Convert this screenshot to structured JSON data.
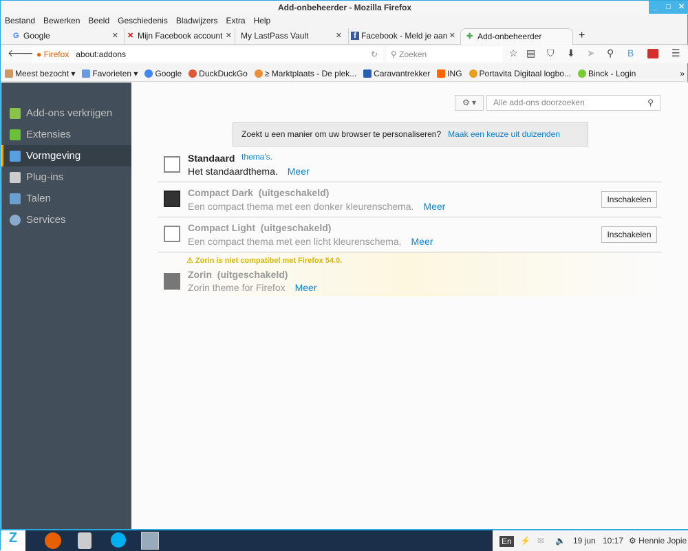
{
  "window": {
    "title": "Add-onbeheerder - Mozilla Firefox",
    "controls": [
      "_",
      "□",
      "✕"
    ]
  },
  "menu": [
    "Bestand",
    "Bewerken",
    "Beeld",
    "Geschiedenis",
    "Bladwijzers",
    "Extra",
    "Help"
  ],
  "tabs": [
    {
      "label": "Google",
      "icon": "G",
      "color": "#4285f4"
    },
    {
      "label": "Mijn Facebook account",
      "icon": "✕",
      "color": "#d00"
    },
    {
      "label": "My LastPass Vault",
      "icon": "",
      "color": "#333"
    },
    {
      "label": "Facebook - Meld je aan",
      "icon": "f",
      "color": "#3b5998"
    },
    {
      "label": "Add-onbeheerder",
      "icon": "✚",
      "color": "#4caf50",
      "active": true
    }
  ],
  "new_tab": "+",
  "nav": {
    "identity": "Firefox",
    "url": "about:addons",
    "search_placeholder": "Zoeken"
  },
  "bookmarks": [
    {
      "label": "Meest bezocht ▾",
      "color": "#c96"
    },
    {
      "label": "Favorieten ▾",
      "color": "#6a9be0"
    },
    {
      "label": "Google",
      "color": "#4285f4"
    },
    {
      "label": "DuckDuckGo",
      "color": "#de5833"
    },
    {
      "label": "≥ Marktplaats - De plek...",
      "color": "#e8913a"
    },
    {
      "label": "Caravantrekker",
      "color": "#2a5fb0"
    },
    {
      "label": "ING",
      "color": "#f60"
    },
    {
      "label": "Portavita Digitaal logbo...",
      "color": "#e8a020"
    },
    {
      "label": "Binck - Login",
      "color": "#7c3"
    }
  ],
  "bookmarks_more": "»",
  "sidebar": [
    {
      "label": "Add-ons verkrijgen",
      "color": "#8bc34a"
    },
    {
      "label": "Extensies",
      "color": "#6bbf3a"
    },
    {
      "label": "Vormgeving",
      "color": "#5aa0e0",
      "selected": true
    },
    {
      "label": "Plug-ins",
      "color": "#ccc"
    },
    {
      "label": "Talen",
      "color": "#6aa0d0"
    },
    {
      "label": "Services",
      "color": "#8ac"
    }
  ],
  "search": {
    "placeholder": "Alle add-ons doorzoeken"
  },
  "banner": {
    "text": "Zoekt u een manier om uw browser te personaliseren?",
    "link": "Maak een keuze uit duizenden thema's."
  },
  "themes": [
    {
      "name": "Standaard",
      "status": "",
      "desc": "Het standaardthema.",
      "more": "Meer",
      "button": ""
    },
    {
      "name": "Compact Dark",
      "status": "(uitgeschakeld)",
      "desc": "Een compact thema met een donker kleurenschema.",
      "more": "Meer",
      "button": "Inschakelen"
    },
    {
      "name": "Compact Light",
      "status": "(uitgeschakeld)",
      "desc": "Een compact thema met een licht kleurenschema.",
      "more": "Meer",
      "button": "Inschakelen"
    },
    {
      "name": "Zorin",
      "status": "(uitgeschakeld)",
      "desc": "Zorin theme for Firefox",
      "more": "Meer",
      "button": "",
      "warning": "Zorin is niet compatibel met Firefox 54.0."
    }
  ],
  "tray": {
    "lang": "En",
    "date": "19 jun",
    "time": "10:17",
    "user": "Hennie Jopie"
  }
}
